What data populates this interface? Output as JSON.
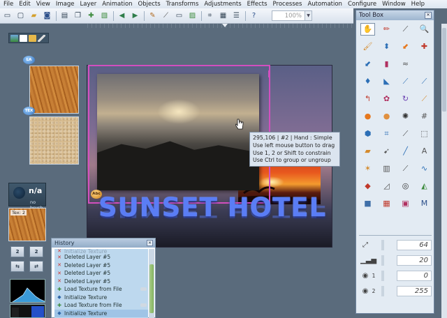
{
  "menu": [
    "File",
    "Edit",
    "View",
    "Image",
    "Layer",
    "Animation",
    "Objects",
    "Transforms",
    "Adjustments",
    "Effects",
    "Processes",
    "Automation",
    "Configure",
    "Window",
    "Help"
  ],
  "toolbar": {
    "buttons_left": [
      "new-document-icon",
      "new-icon",
      "open-icon",
      "save-icon"
    ],
    "buttons_mid": [
      "new-layer-icon",
      "duplicate-icon",
      "add-icon",
      "layer-icon",
      "arrow-left-icon",
      "arrow-right-icon",
      "pen-tool-icon",
      "brush-icon",
      "rectangle-icon",
      "image-icon",
      "crop-icon",
      "grid-icon",
      "list-icon",
      "help-icon"
    ],
    "zoom_value": "100%"
  },
  "textures": {
    "badge1": "LA",
    "badge2": "TEX"
  },
  "brush": {
    "value": "n/a",
    "label": "no brush"
  },
  "texture_panel": {
    "label": "Tex: 2"
  },
  "left_buttons": [
    "2",
    "2",
    "⇆",
    "⇄"
  ],
  "canvas": {
    "title_text": "SUNSET HOTEL",
    "text_icon_label": "Abc"
  },
  "tooltip": {
    "line1": "295,106 | #2 | Hand : Simple",
    "line2": "Use left mouse button to drag",
    "line3": "Use 1, 2 or Shift to constrain",
    "line4": "Use Ctrl to group or ungroup"
  },
  "history": {
    "title": "History",
    "items": [
      {
        "icon": "x",
        "label": "Initialize Texture",
        "dim": true
      },
      {
        "icon": "x",
        "label": "Deleted Layer #5"
      },
      {
        "icon": "x",
        "label": "Deleted Layer #5"
      },
      {
        "icon": "x",
        "label": "Deleted Layer #5"
      },
      {
        "icon": "x",
        "label": "Deleted Layer #5"
      },
      {
        "icon": "p",
        "label": "Load Texture from File"
      },
      {
        "icon": "t",
        "label": "Initialize Texture"
      },
      {
        "icon": "p",
        "label": "Load Texture from File"
      },
      {
        "icon": "t",
        "label": "Initialize Texture"
      }
    ]
  },
  "toolbox": {
    "title": "Tool Box",
    "tools": [
      {
        "name": "hand-tool-icon",
        "glyph": "✋",
        "color": "#333333"
      },
      {
        "name": "pen-icon",
        "glyph": "✏",
        "color": "#c0392b"
      },
      {
        "name": "eyedropper-icon",
        "glyph": "⟋",
        "color": "#444444"
      },
      {
        "name": "zoom-icon",
        "glyph": "🔍",
        "color": "#444444"
      },
      {
        "name": "paintbrush-icon",
        "glyph": "🖌",
        "color": "#d48a2c"
      },
      {
        "name": "paint-icon",
        "glyph": "⬍",
        "color": "#2c6fb6"
      },
      {
        "name": "brush-orange-icon",
        "glyph": "⬋",
        "color": "#e6781e"
      },
      {
        "name": "plus-brush-icon",
        "glyph": "✚",
        "color": "#c0392b"
      },
      {
        "name": "brush-blue-icon",
        "glyph": "⬋",
        "color": "#2c6fb6"
      },
      {
        "name": "tube-icon",
        "glyph": "▮",
        "color": "#b03060"
      },
      {
        "name": "wave-icon",
        "glyph": "≈",
        "color": "#555555"
      },
      {
        "name": "empty-icon",
        "glyph": "",
        "color": "#555555"
      },
      {
        "name": "drop-icon",
        "glyph": "♦",
        "color": "#2c6fb6"
      },
      {
        "name": "triangle-icon",
        "glyph": "◣",
        "color": "#2c6fb6"
      },
      {
        "name": "marker-icon",
        "glyph": "⟋",
        "color": "#2c6fb6"
      },
      {
        "name": "marker2-icon",
        "glyph": "⟋",
        "color": "#2c6fb6"
      },
      {
        "name": "curve-icon",
        "glyph": "↰",
        "color": "#c0392b"
      },
      {
        "name": "flower-icon",
        "glyph": "✿",
        "color": "#b03060"
      },
      {
        "name": "rotate-icon",
        "glyph": "↻",
        "color": "#6a3fb0"
      },
      {
        "name": "brush3-icon",
        "glyph": "⟋",
        "color": "#d48a2c"
      },
      {
        "name": "orange-sphere-icon",
        "glyph": "●",
        "color": "#e6781e"
      },
      {
        "name": "sphere2-icon",
        "glyph": "●",
        "color": "#e09040"
      },
      {
        "name": "splash-icon",
        "glyph": "✺",
        "color": "#333333"
      },
      {
        "name": "network-icon",
        "glyph": "#",
        "color": "#555555"
      },
      {
        "name": "bucket-icon",
        "glyph": "⬢",
        "color": "#2c6fb6"
      },
      {
        "name": "crop-icon",
        "glyph": "⌗",
        "color": "#2c6fb6"
      },
      {
        "name": "dropper-icon",
        "glyph": "⟋",
        "color": "#444444"
      },
      {
        "name": "select-icon",
        "glyph": "⬚",
        "color": "#444444"
      },
      {
        "name": "eraser-icon",
        "glyph": "▰",
        "color": "#d48a2c"
      },
      {
        "name": "lasso-icon",
        "glyph": "➹",
        "color": "#555555"
      },
      {
        "name": "line-icon",
        "glyph": "╱",
        "color": "#2c6fb6"
      },
      {
        "name": "text-icon",
        "glyph": "A",
        "color": "#555555"
      },
      {
        "name": "star-icon",
        "glyph": "✶",
        "color": "#d48a2c"
      },
      {
        "name": "chart-icon",
        "glyph": "▥",
        "color": "#555555"
      },
      {
        "name": "pipette-icon",
        "glyph": "⟋",
        "color": "#444444"
      },
      {
        "name": "bezier-icon",
        "glyph": "∿",
        "color": "#2c6fb6"
      },
      {
        "name": "gradient-icon",
        "glyph": "◆",
        "color": "#c0392b"
      },
      {
        "name": "magnet-icon",
        "glyph": "◿",
        "color": "#555555"
      },
      {
        "name": "circle-icon",
        "glyph": "◎",
        "color": "#333333"
      },
      {
        "name": "shape-icon",
        "glyph": "◭",
        "color": "#3b8a3b"
      },
      {
        "name": "cube-icon",
        "glyph": "■",
        "color": "#3f6fa8"
      },
      {
        "name": "palette-icon",
        "glyph": "▦",
        "color": "#c0392b"
      },
      {
        "name": "frame-icon",
        "glyph": "▣",
        "color": "#b03060"
      },
      {
        "name": "m-icon",
        "glyph": "M",
        "color": "#2c4f8a"
      }
    ],
    "props": [
      {
        "icon": "resize-icon",
        "glyph": "⤢",
        "num": "",
        "value": "64"
      },
      {
        "icon": "opacity-bars-icon",
        "glyph": "▁▃▅",
        "num": "",
        "value": "20"
      },
      {
        "icon": "eye-icon",
        "glyph": "◉",
        "num": "1",
        "value": "0"
      },
      {
        "icon": "eye-icon",
        "glyph": "◉",
        "num": "2",
        "value": "255"
      }
    ]
  }
}
